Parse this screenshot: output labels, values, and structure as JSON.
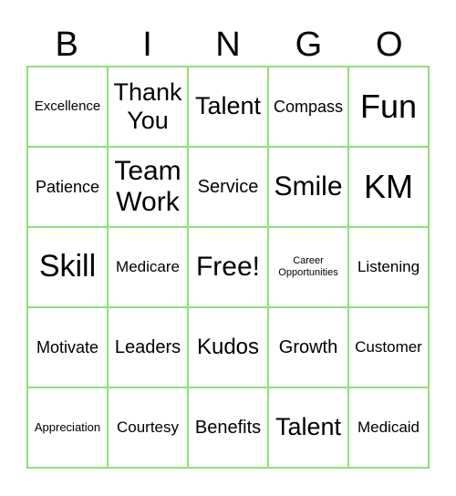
{
  "header": [
    "B",
    "I",
    "N",
    "G",
    "O"
  ],
  "colors": {
    "border": "#8fe07a"
  },
  "cells": [
    "Excellence",
    "Thank You",
    "Talent",
    "Compass",
    "Fun",
    "Patience",
    "Team Work",
    "Service",
    "Smile",
    "KM",
    "Skill",
    "Medicare",
    "Free!",
    "Career Opportunities",
    "Listening",
    "Motivate",
    "Leaders",
    "Kudos",
    "Growth",
    "Customer",
    "Appreciation",
    "Courtesy",
    "Benefits",
    "Talent",
    "Medicaid"
  ]
}
